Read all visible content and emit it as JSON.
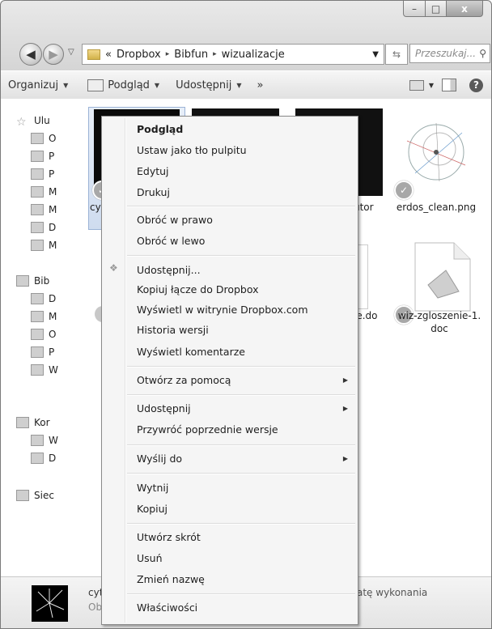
{
  "window": {
    "caption": {
      "minimize": "–",
      "maximize": "□",
      "close": "x"
    }
  },
  "address": {
    "overflow": "«",
    "segments": [
      "Dropbox",
      "Bibfun",
      "wizualizacje"
    ],
    "separator": "▸",
    "search_placeholder": "Przeszukaj..."
  },
  "toolbar": {
    "organize": "Organizuj",
    "preview": "Podgląd",
    "share": "Udostępnij",
    "more": "»"
  },
  "nav_pane": {
    "items": [
      {
        "label": "Ulu",
        "level": 0
      },
      {
        "label": "O",
        "level": 1
      },
      {
        "label": "P",
        "level": 1
      },
      {
        "label": "P",
        "level": 1
      },
      {
        "label": "M",
        "level": 1
      },
      {
        "label": "M",
        "level": 1
      },
      {
        "label": "D",
        "level": 1
      },
      {
        "label": "M",
        "level": 1
      },
      {
        "label": "Bib",
        "level": 0
      },
      {
        "label": "D",
        "level": 1
      },
      {
        "label": "M",
        "level": 1
      },
      {
        "label": "O",
        "level": 1
      },
      {
        "label": "P",
        "level": 1
      },
      {
        "label": "W",
        "level": 1
      },
      {
        "label": "Kor",
        "level": 0
      },
      {
        "label": "W",
        "level": 1
      },
      {
        "label": "D",
        "level": 1
      },
      {
        "label": "Siec",
        "level": 0
      }
    ]
  },
  "files": [
    {
      "label": "cy"
    },
    {
      "label": "utor"
    },
    {
      "label": "erdos_clean.png"
    },
    {
      "label": "ie.do"
    },
    {
      "label": "wiz-zgloszenie-1.\ndoc"
    }
  ],
  "details": {
    "name": "cyt",
    "type": "Ob",
    "property": "atę wykonania"
  },
  "context_menu": {
    "groups": [
      {
        "items": [
          {
            "label": "Podgląd",
            "bold": true
          },
          {
            "label": "Ustaw jako tło pulpitu"
          },
          {
            "label": "Edytuj"
          },
          {
            "label": "Drukuj"
          }
        ]
      },
      {
        "items": [
          {
            "label": "Obróć w prawo"
          },
          {
            "label": "Obróć w lewo"
          }
        ]
      },
      {
        "items": [
          {
            "label": "Udostępnij..."
          },
          {
            "label": "Kopiuj łącze do Dropbox"
          },
          {
            "label": "Wyświetl w witrynie Dropbox.com"
          },
          {
            "label": "Historia wersji"
          },
          {
            "label": "Wyświetl komentarze"
          }
        ]
      },
      {
        "items": [
          {
            "label": "Otwórz za pomocą",
            "submenu": true
          }
        ]
      },
      {
        "items": [
          {
            "label": "Udostępnij",
            "submenu": true
          },
          {
            "label": "Przywróć poprzednie wersje"
          }
        ]
      },
      {
        "items": [
          {
            "label": "Wyślij do",
            "submenu": true
          }
        ]
      },
      {
        "items": [
          {
            "label": "Wytnij"
          },
          {
            "label": "Kopiuj"
          }
        ]
      },
      {
        "items": [
          {
            "label": "Utwórz skrót"
          },
          {
            "label": "Usuń"
          },
          {
            "label": "Zmień nazwę"
          }
        ]
      },
      {
        "items": [
          {
            "label": "Właściwości"
          }
        ]
      }
    ]
  }
}
